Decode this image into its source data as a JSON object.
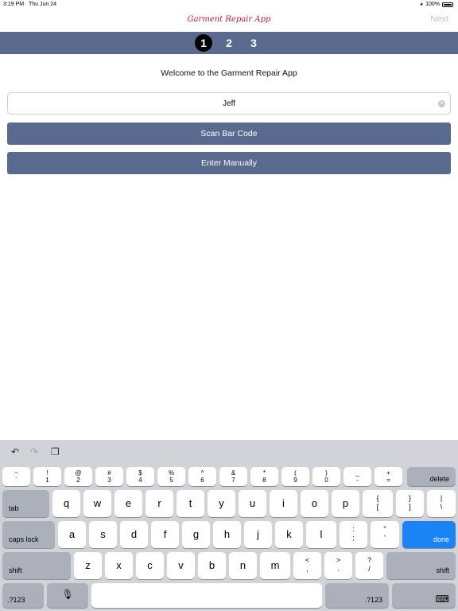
{
  "status": {
    "time": "3:19 PM",
    "date": "Thu Jun 24",
    "battery": "100%"
  },
  "nav": {
    "title": "Garment Repair App",
    "next_label": "Next"
  },
  "steps": [
    "1",
    "2",
    "3"
  ],
  "main": {
    "welcome": "Welcome to the Garment Repair App",
    "name_value": "Jeff",
    "scan_label": "Scan Bar Code",
    "manual_label": "Enter Manually"
  },
  "colors": {
    "accent": "#5a6a8f",
    "title": "#b2203f",
    "done": "#1a83f6"
  },
  "keyboard": {
    "toolbar": [
      "undo-icon",
      "redo-icon",
      "clipboard-icon"
    ],
    "row0": [
      {
        "top": "~",
        "bottom": "`"
      },
      {
        "top": "!",
        "bottom": "1"
      },
      {
        "top": "@",
        "bottom": "2"
      },
      {
        "top": "#",
        "bottom": "3"
      },
      {
        "top": "$",
        "bottom": "4"
      },
      {
        "top": "%",
        "bottom": "5"
      },
      {
        "top": "^",
        "bottom": "6"
      },
      {
        "top": "&",
        "bottom": "7"
      },
      {
        "top": "*",
        "bottom": "8"
      },
      {
        "top": "(",
        "bottom": "9"
      },
      {
        "top": ")",
        "bottom": "0"
      },
      {
        "top": "_",
        "bottom": "-"
      },
      {
        "top": "+",
        "bottom": "="
      }
    ],
    "delete": "delete",
    "tab": "tab",
    "row1": [
      "q",
      "w",
      "e",
      "r",
      "t",
      "y",
      "u",
      "i",
      "o",
      "p"
    ],
    "row1_sym": [
      {
        "top": "{",
        "bottom": "["
      },
      {
        "top": "}",
        "bottom": "]"
      },
      {
        "top": "|",
        "bottom": "\\"
      }
    ],
    "caps": "caps lock",
    "row2": [
      "a",
      "s",
      "d",
      "f",
      "g",
      "h",
      "j",
      "k",
      "l"
    ],
    "row2_sym": [
      {
        "top": ":",
        "bottom": ";"
      },
      {
        "top": "\"",
        "bottom": "'"
      }
    ],
    "done": "done",
    "shift": "shift",
    "row3": [
      "z",
      "x",
      "c",
      "v",
      "b",
      "n",
      "m"
    ],
    "row3_sym": [
      {
        "top": "<",
        "bottom": ","
      },
      {
        "top": ">",
        "bottom": "."
      },
      {
        "top": "?",
        "bottom": "/"
      }
    ],
    "numkey": ".?123"
  }
}
